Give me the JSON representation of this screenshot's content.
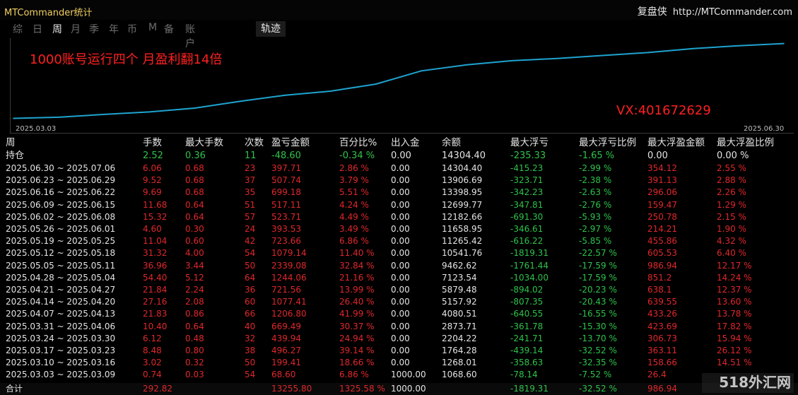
{
  "window": {
    "title": "MTCommander统计",
    "brand_name": "复盘侠",
    "brand_url": "http://MTCommander.com"
  },
  "tabs": [
    "综",
    "日",
    "周",
    "月",
    "季",
    "年",
    "币",
    "M",
    "备",
    "账户"
  ],
  "active_tab": "周",
  "track_tab": "轨迹",
  "chart": {
    "headline": "1000账号运行四个 月盈利翻14倍",
    "contact": "VX:401672629",
    "start_date": "2025.03.03",
    "end_date": "2025.06.30",
    "line_color": "#1fa3d0"
  },
  "chart_data": {
    "type": "line",
    "title": "",
    "xlabel": "",
    "ylabel": "",
    "x": [
      "2025.03.03",
      "2025.03.10",
      "2025.03.17",
      "2025.03.24",
      "2025.03.31",
      "2025.04.07",
      "2025.04.14",
      "2025.04.21",
      "2025.04.28",
      "2025.05.05",
      "2025.05.12",
      "2025.05.19",
      "2025.05.26",
      "2025.06.02",
      "2025.06.09",
      "2025.06.16",
      "2025.06.23",
      "2025.06.30"
    ],
    "series": [
      {
        "name": "",
        "values": [
          1068.6,
          1268.01,
          1764.28,
          2204.22,
          2873.71,
          4080.51,
          5157.92,
          5879.48,
          7123.54,
          9462.62,
          10541.76,
          11265.42,
          11658.95,
          12182.66,
          12699.77,
          13398.95,
          13906.69,
          14304.4
        ]
      }
    ],
    "ylim": [
      0,
      15000
    ],
    "grid": false
  },
  "table": {
    "headers": [
      "周",
      "手数",
      "最大手数",
      "次数",
      "盈亏金额",
      "百分比%",
      "出入金",
      "余额",
      "最大浮亏",
      "最大浮亏比例",
      "最大浮盈金额",
      "最大浮盈比例"
    ],
    "holding": {
      "label": "持仓",
      "lots": "2.52",
      "max_lots": "0.36",
      "count": "11",
      "pnl": "-48.60",
      "pct": "-0.34 %",
      "flow": "0.00",
      "balance": "14304.40",
      "max_float_loss": "-235.33",
      "max_float_loss_pct": "-1.65 %",
      "max_float_profit": "0.00",
      "max_float_profit_pct": "0.00 %"
    },
    "rows": [
      {
        "period": "2025.06.30 ~ 2025.07.06",
        "lots": "6.06",
        "max_lots": "0.68",
        "count": "23",
        "pnl": "397.71",
        "pct": "2.86 %",
        "flow": "0.00",
        "balance": "14304.40",
        "max_float_loss": "-415.23",
        "max_float_loss_pct": "-2.99 %",
        "max_float_profit": "354.12",
        "max_float_profit_pct": "2.55 %"
      },
      {
        "period": "2025.06.23 ~ 2025.06.29",
        "lots": "9.52",
        "max_lots": "0.68",
        "count": "37",
        "pnl": "507.74",
        "pct": "3.79 %",
        "flow": "0.00",
        "balance": "13906.69",
        "max_float_loss": "-323.71",
        "max_float_loss_pct": "-2.38 %",
        "max_float_profit": "391.13",
        "max_float_profit_pct": "2.88 %"
      },
      {
        "period": "2025.06.16 ~ 2025.06.22",
        "lots": "9.69",
        "max_lots": "0.68",
        "count": "35",
        "pnl": "699.18",
        "pct": "5.51 %",
        "flow": "0.00",
        "balance": "13398.95",
        "max_float_loss": "-342.23",
        "max_float_loss_pct": "-2.63 %",
        "max_float_profit": "296.06",
        "max_float_profit_pct": "2.26 %"
      },
      {
        "period": "2025.06.09 ~ 2025.06.15",
        "lots": "11.68",
        "max_lots": "0.64",
        "count": "51",
        "pnl": "517.11",
        "pct": "4.24 %",
        "flow": "0.00",
        "balance": "12699.77",
        "max_float_loss": "-347.81",
        "max_float_loss_pct": "-2.76 %",
        "max_float_profit": "159.47",
        "max_float_profit_pct": "1.29 %"
      },
      {
        "period": "2025.06.02 ~ 2025.06.08",
        "lots": "15.32",
        "max_lots": "0.64",
        "count": "57",
        "pnl": "523.71",
        "pct": "4.49 %",
        "flow": "0.00",
        "balance": "12182.66",
        "max_float_loss": "-691.30",
        "max_float_loss_pct": "-5.93 %",
        "max_float_profit": "250.78",
        "max_float_profit_pct": "2.15 %"
      },
      {
        "period": "2025.05.26 ~ 2025.06.01",
        "lots": "4.60",
        "max_lots": "0.30",
        "count": "24",
        "pnl": "393.53",
        "pct": "3.49 %",
        "flow": "0.00",
        "balance": "11658.95",
        "max_float_loss": "-346.61",
        "max_float_loss_pct": "-2.97 %",
        "max_float_profit": "214.21",
        "max_float_profit_pct": "1.90 %"
      },
      {
        "period": "2025.05.19 ~ 2025.05.25",
        "lots": "11.04",
        "max_lots": "0.60",
        "count": "42",
        "pnl": "723.66",
        "pct": "6.86 %",
        "flow": "0.00",
        "balance": "11265.42",
        "max_float_loss": "-616.22",
        "max_float_loss_pct": "-5.85 %",
        "max_float_profit": "455.86",
        "max_float_profit_pct": "4.32 %"
      },
      {
        "period": "2025.05.12 ~ 2025.05.18",
        "lots": "31.32",
        "max_lots": "4.00",
        "count": "54",
        "pnl": "1079.14",
        "pct": "11.40 %",
        "flow": "0.00",
        "balance": "10541.76",
        "max_float_loss": "-1819.31",
        "max_float_loss_pct": "-22.57 %",
        "max_float_profit": "605.53",
        "max_float_profit_pct": "6.40 %"
      },
      {
        "period": "2025.05.05 ~ 2025.05.11",
        "lots": "36.96",
        "max_lots": "3.44",
        "count": "50",
        "pnl": "2339.08",
        "pct": "32.84 %",
        "flow": "0.00",
        "balance": "9462.62",
        "max_float_loss": "-1761.44",
        "max_float_loss_pct": "-17.59 %",
        "max_float_profit": "986.94",
        "max_float_profit_pct": "12.17 %"
      },
      {
        "period": "2025.04.28 ~ 2025.05.04",
        "lots": "54.40",
        "max_lots": "5.12",
        "count": "64",
        "pnl": "1244.06",
        "pct": "21.16 %",
        "flow": "0.00",
        "balance": "7123.54",
        "max_float_loss": "-1034.00",
        "max_float_loss_pct": "-17.59 %",
        "max_float_profit": "851.2",
        "max_float_profit_pct": "14.24 %"
      },
      {
        "period": "2025.04.21 ~ 2025.04.27",
        "lots": "21.84",
        "max_lots": "2.24",
        "count": "36",
        "pnl": "721.56",
        "pct": "13.99 %",
        "flow": "0.00",
        "balance": "5879.48",
        "max_float_loss": "-894.02",
        "max_float_loss_pct": "-20.23 %",
        "max_float_profit": "638.1",
        "max_float_profit_pct": "12.37 %"
      },
      {
        "period": "2025.04.14 ~ 2025.04.20",
        "lots": "27.16",
        "max_lots": "2.08",
        "count": "60",
        "pnl": "1077.41",
        "pct": "26.40 %",
        "flow": "0.00",
        "balance": "5157.92",
        "max_float_loss": "-807.35",
        "max_float_loss_pct": "-20.43 %",
        "max_float_profit": "639.55",
        "max_float_profit_pct": "13.60 %"
      },
      {
        "period": "2025.04.07 ~ 2025.04.13",
        "lots": "21.83",
        "max_lots": "0.86",
        "count": "66",
        "pnl": "1206.80",
        "pct": "41.99 %",
        "flow": "0.00",
        "balance": "4080.51",
        "max_float_loss": "-640.55",
        "max_float_loss_pct": "-16.55 %",
        "max_float_profit": "433.26",
        "max_float_profit_pct": "13.78 %"
      },
      {
        "period": "2025.03.31 ~ 2025.04.06",
        "lots": "10.40",
        "max_lots": "0.64",
        "count": "40",
        "pnl": "669.49",
        "pct": "30.37 %",
        "flow": "0.00",
        "balance": "2873.71",
        "max_float_loss": "-361.78",
        "max_float_loss_pct": "-15.30 %",
        "max_float_profit": "423.69",
        "max_float_profit_pct": "17.82 %"
      },
      {
        "period": "2025.03.24 ~ 2025.03.30",
        "lots": "6.12",
        "max_lots": "0.48",
        "count": "32",
        "pnl": "439.94",
        "pct": "24.94 %",
        "flow": "0.00",
        "balance": "2204.22",
        "max_float_loss": "-241.71",
        "max_float_loss_pct": "-13.70 %",
        "max_float_profit": "306.73",
        "max_float_profit_pct": "15.94 %"
      },
      {
        "period": "2025.03.17 ~ 2025.03.23",
        "lots": "8.48",
        "max_lots": "0.80",
        "count": "38",
        "pnl": "496.27",
        "pct": "39.14 %",
        "flow": "0.00",
        "balance": "1764.28",
        "max_float_loss": "-439.14",
        "max_float_loss_pct": "-32.52 %",
        "max_float_profit": "363.11",
        "max_float_profit_pct": "26.12 %"
      },
      {
        "period": "2025.03.10 ~ 2025.03.16",
        "lots": "3.02",
        "max_lots": "0.32",
        "count": "50",
        "pnl": "199.41",
        "pct": "18.66 %",
        "flow": "0.00",
        "balance": "1268.01",
        "max_float_loss": "-358.63",
        "max_float_loss_pct": "-32.35 %",
        "max_float_profit": "158.66",
        "max_float_profit_pct": "14.51 %"
      },
      {
        "period": "2025.03.03 ~ 2025.03.09",
        "lots": "0.74",
        "max_lots": "0.03",
        "count": "54",
        "pnl": "68.60",
        "pct": "6.86 %",
        "flow": "1000.00",
        "balance": "1068.60",
        "max_float_loss": "-78.14",
        "max_float_loss_pct": "-7.52 %",
        "max_float_profit": "26.4",
        "max_float_profit_pct": ""
      }
    ],
    "total": {
      "label": "合计",
      "lots": "292.82",
      "max_lots": "",
      "count": "",
      "pnl": "13255.80",
      "pct": "1325.58 %",
      "flow": "1000.00",
      "balance": "",
      "max_float_loss": "-1819.31",
      "max_float_loss_pct": "-32.52 %",
      "max_float_profit": "986.94",
      "max_float_profit_pct": ""
    }
  },
  "watermark": "518外汇网",
  "colors": {
    "profit": "#e0272b",
    "loss": "#2ec24a",
    "title": "#f0d060",
    "curve": "#1fa3d0",
    "headline": "#ff2020"
  }
}
